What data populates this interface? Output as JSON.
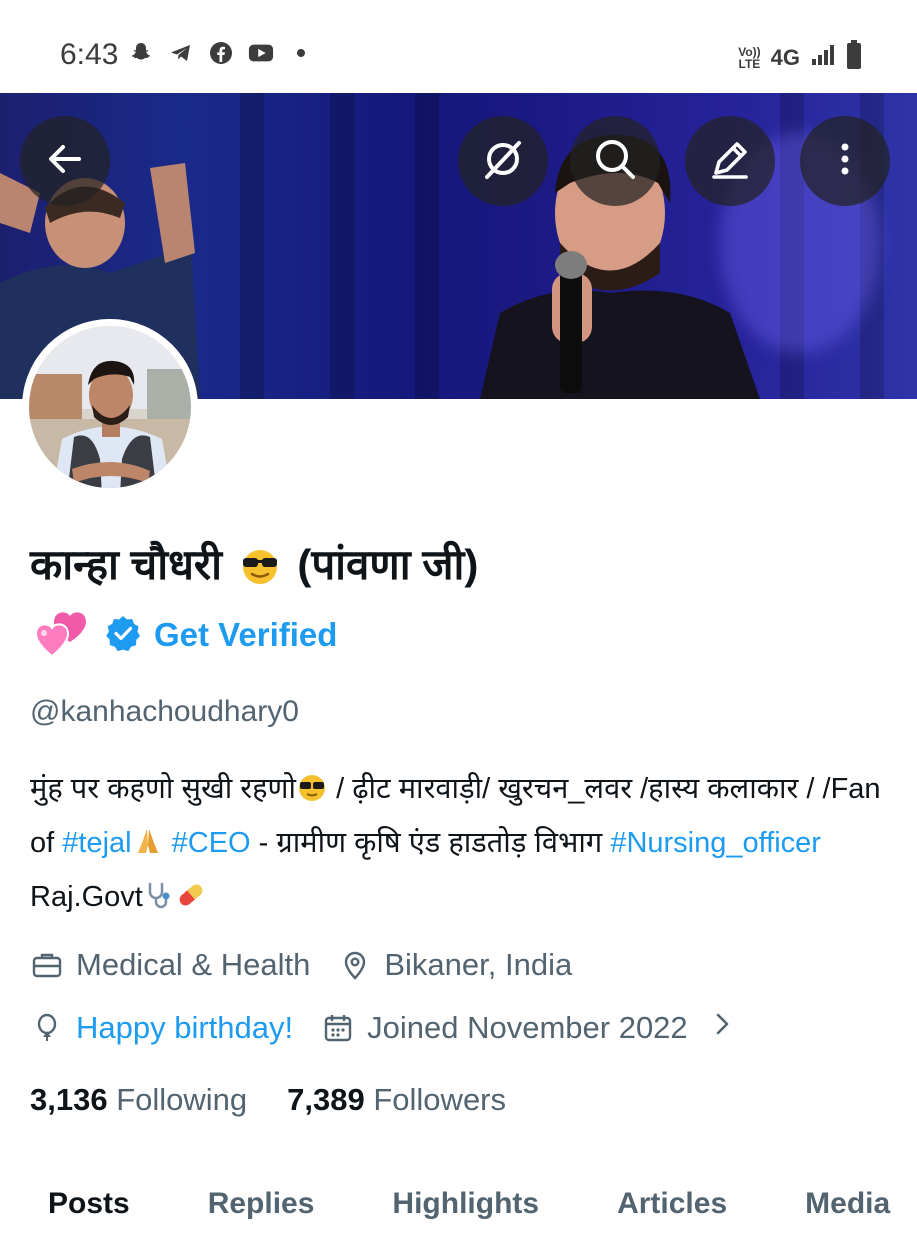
{
  "status_bar": {
    "time": "6:43",
    "left_icons": [
      "snapchat-icon",
      "telegram-icon",
      "facebook-icon",
      "youtube-icon",
      "dot-icon"
    ],
    "volte_top": "Vo))",
    "volte_bottom": "LTE",
    "network": "4G"
  },
  "header_buttons": [
    "back-arrow-icon",
    "grok-icon",
    "search-icon",
    "edit-icon",
    "more-icon"
  ],
  "profile": {
    "name": "कान्हा चौधरी",
    "name_suffix": "(पांवणा जी)",
    "get_verified": "Get Verified",
    "handle": "@kanhachoudhary0",
    "bio": {
      "part1": "मुंह पर कहणो सुखी रहणो",
      "part2": " / ढ़ीट मारवाड़ी/ खुरचन_लवर /हास्य कलाकार / /Fan of ",
      "tag1": "#tejal",
      "part3": " ",
      "tag2": "#CEO",
      "part4": " - ग्रामीण कृषि एंड हाडतोड़ विभाग ",
      "tag3": "#Nursing_officer",
      "part5": " Raj.Govt"
    },
    "category": "Medical & Health",
    "location": "Bikaner, India",
    "birthday": "Happy birthday!",
    "joined": "Joined November 2022",
    "following_count": "3,136",
    "following_label": "Following",
    "followers_count": "7,389",
    "followers_label": "Followers"
  },
  "tabs": [
    "Posts",
    "Replies",
    "Highlights",
    "Articles",
    "Media"
  ],
  "colors": {
    "accent": "#1d9bf0",
    "secondary_text": "#536471",
    "primary_text": "#0f1419"
  }
}
